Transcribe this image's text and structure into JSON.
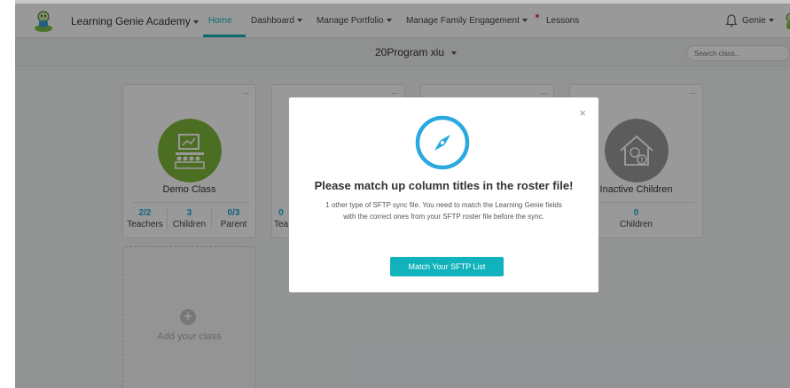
{
  "nav": {
    "org_name": "Learning Genie Academy",
    "items": [
      "Home",
      "Dashboard",
      "Manage Portfolio",
      "Manage Family Engagement",
      "Lessons"
    ],
    "user_name": "Genie"
  },
  "subheader": {
    "program": "20Program xiu",
    "search_placeholder": "Search class..."
  },
  "cards": [
    {
      "name": "Demo Class",
      "menu": "...",
      "stats": [
        {
          "num": "2/2",
          "label": "Teachers"
        },
        {
          "num": "3",
          "label": "Children"
        },
        {
          "num": "0/3",
          "label": "Parent"
        }
      ]
    },
    {
      "name": "Inactive Children",
      "menu": "...",
      "stats": [
        {
          "num": "0",
          "label": "Children"
        }
      ]
    }
  ],
  "hidden_card": {
    "menu": "...",
    "num": "0",
    "label": "Tea"
  },
  "hidden_card2": {
    "menu": "..."
  },
  "add_class_label": "Add your class",
  "modal": {
    "close": "×",
    "title": "Please match up column titles in the roster file!",
    "body_line1": "1 other type of SFTP sync file. You need to match the Learning Genie fields",
    "body_line2": "with the correct ones from your SFTP roster file before the sync.",
    "button": "Match Your SFTP List"
  },
  "colors": {
    "accent": "#10b3bb",
    "stat_number": "#1aa9cf",
    "demo_class_icon": "#7db83a",
    "inactive_icon": "#9a9a9a",
    "compass": "#2aa8e0"
  }
}
